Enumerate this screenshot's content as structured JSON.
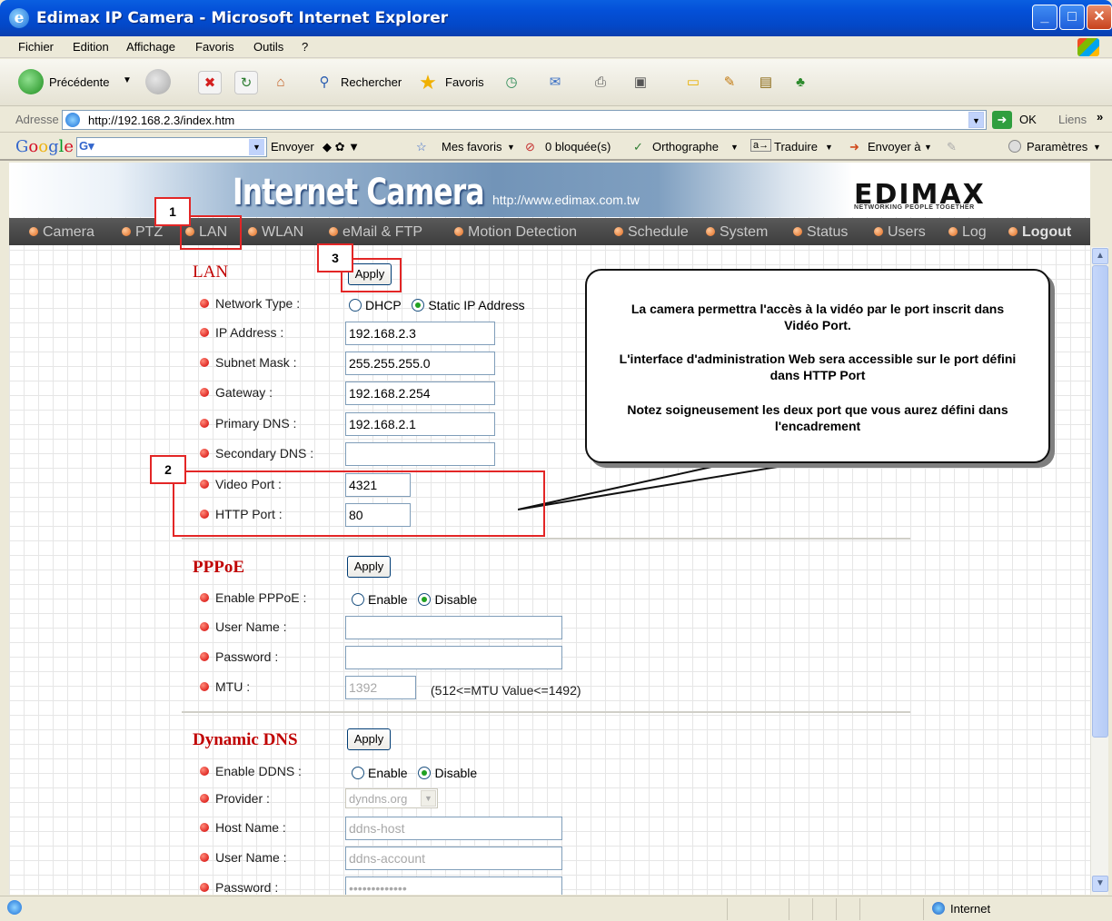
{
  "window": {
    "title": "Edimax IP Camera - Microsoft Internet Explorer"
  },
  "menu": [
    "Fichier",
    "Edition",
    "Affichage",
    "Favoris",
    "Outils",
    "?"
  ],
  "toolbar": {
    "back": "Précédente",
    "search": "Rechercher",
    "favorites": "Favoris"
  },
  "address": {
    "label": "Adresse",
    "url": "http://192.168.2.3/index.htm",
    "go": "OK",
    "links": "Liens"
  },
  "googlebar": {
    "send": "Envoyer",
    "bookmarks": "Mes favoris",
    "blocked": "0 bloquée(s)",
    "spell": "Orthographe",
    "translate": "Traduire",
    "send_to": "Envoyer à",
    "settings": "Paramètres"
  },
  "banner": {
    "title": "Internet Camera",
    "url": "http://www.edimax.com.tw",
    "brand": "EDIMAX",
    "tagline": "NETWORKING PEOPLE TOGETHER"
  },
  "nav": [
    "Camera",
    "PTZ",
    "LAN",
    "WLAN",
    "eMail & FTP",
    "Motion Detection",
    "Schedule",
    "System",
    "Status",
    "Users",
    "Log",
    "Logout"
  ],
  "lan": {
    "title": "LAN",
    "apply": "Apply",
    "network_type_label": "Network Type :",
    "dhcp": "DHCP",
    "static": "Static IP Address",
    "ip_label": "IP Address :",
    "ip": "192.168.2.3",
    "mask_label": "Subnet Mask :",
    "mask": "255.255.255.0",
    "gateway_label": "Gateway :",
    "gateway": "192.168.2.254",
    "dns1_label": "Primary DNS :",
    "dns1": "192.168.2.1",
    "dns2_label": "Secondary DNS :",
    "dns2": "",
    "video_port_label": "Video Port :",
    "video_port": "4321",
    "http_port_label": "HTTP Port :",
    "http_port": "80"
  },
  "pppoe": {
    "title": "PPPoE",
    "apply": "Apply",
    "enable_label": "Enable PPPoE :",
    "enable": "Enable",
    "disable": "Disable",
    "user_label": "User Name :",
    "user": "",
    "password_label": "Password :",
    "password": "",
    "mtu_label": "MTU :",
    "mtu": "1392",
    "mtu_hint": "(512<=MTU Value<=1492)"
  },
  "ddns": {
    "title": "Dynamic DNS",
    "apply": "Apply",
    "enable_label": "Enable DDNS :",
    "enable": "Enable",
    "disable": "Disable",
    "provider_label": "Provider :",
    "provider": "dyndns.org",
    "host_label": "Host Name :",
    "host": "ddns-host",
    "user_label": "User Name :",
    "user": "ddns-account",
    "password_label": "Password :",
    "password": "•••••••••••••"
  },
  "callout": {
    "p1": "La camera permettra l'accès à la vidéo par le port inscrit dans Vidéo Port.",
    "p2": "L'interface d'administration Web sera accessible sur le port défini dans HTTP Port",
    "p3": "Notez soigneusement les deux port que vous aurez défini dans l'encadrement"
  },
  "markers": [
    "1",
    "2",
    "3"
  ],
  "status": {
    "zone": "Internet"
  }
}
